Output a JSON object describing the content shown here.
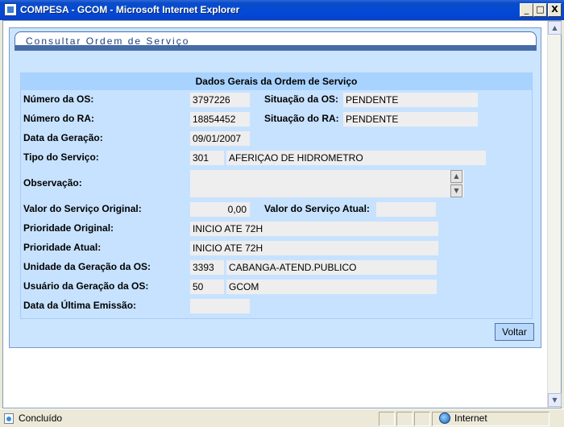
{
  "window": {
    "title": "COMPESA - GCOM - Microsoft Internet Explorer",
    "minimize": "_",
    "maximize": "□",
    "close": "X"
  },
  "panel": {
    "title": "Consultar Ordem de Serviço"
  },
  "form": {
    "header": "Dados Gerais da Ordem de Serviço",
    "numero_os_label": "Número da OS:",
    "numero_os_value": "3797226",
    "situacao_os_label": "Situação da OS:",
    "situacao_os_value": "PENDENTE",
    "numero_ra_label": "Número do RA:",
    "numero_ra_value": "18854452",
    "situacao_ra_label": "Situação do RA:",
    "situacao_ra_value": "PENDENTE",
    "data_geracao_label": "Data da Geração:",
    "data_geracao_value": "09/01/2007",
    "tipo_servico_label": "Tipo do Serviço:",
    "tipo_servico_code": "301",
    "tipo_servico_desc": "AFERIÇAO DE HIDROMETRO",
    "observacao_label": "Observação:",
    "observacao_value": "",
    "valor_original_label": "Valor do Serviço Original:",
    "valor_original_value": "0,00",
    "valor_atual_label": "Valor do Serviço Atual:",
    "valor_atual_value": "",
    "prioridade_original_label": "Prioridade Original:",
    "prioridade_original_value": "INICIO ATE 72H",
    "prioridade_atual_label": "Prioridade Atual:",
    "prioridade_atual_value": "INICIO ATE 72H",
    "unidade_label": "Unidade da Geração da OS:",
    "unidade_code": "3393",
    "unidade_desc": "CABANGA-ATEND.PUBLICO",
    "usuario_label": "Usuário da Geração da OS:",
    "usuario_code": "50",
    "usuario_desc": "GCOM",
    "ultima_emissao_label": "Data da Última Emissão:",
    "ultima_emissao_value": ""
  },
  "actions": {
    "voltar": "Voltar"
  },
  "statusbar": {
    "status": "Concluído",
    "zone": "Internet"
  },
  "scroll": {
    "up": "▲",
    "down": "▼"
  }
}
